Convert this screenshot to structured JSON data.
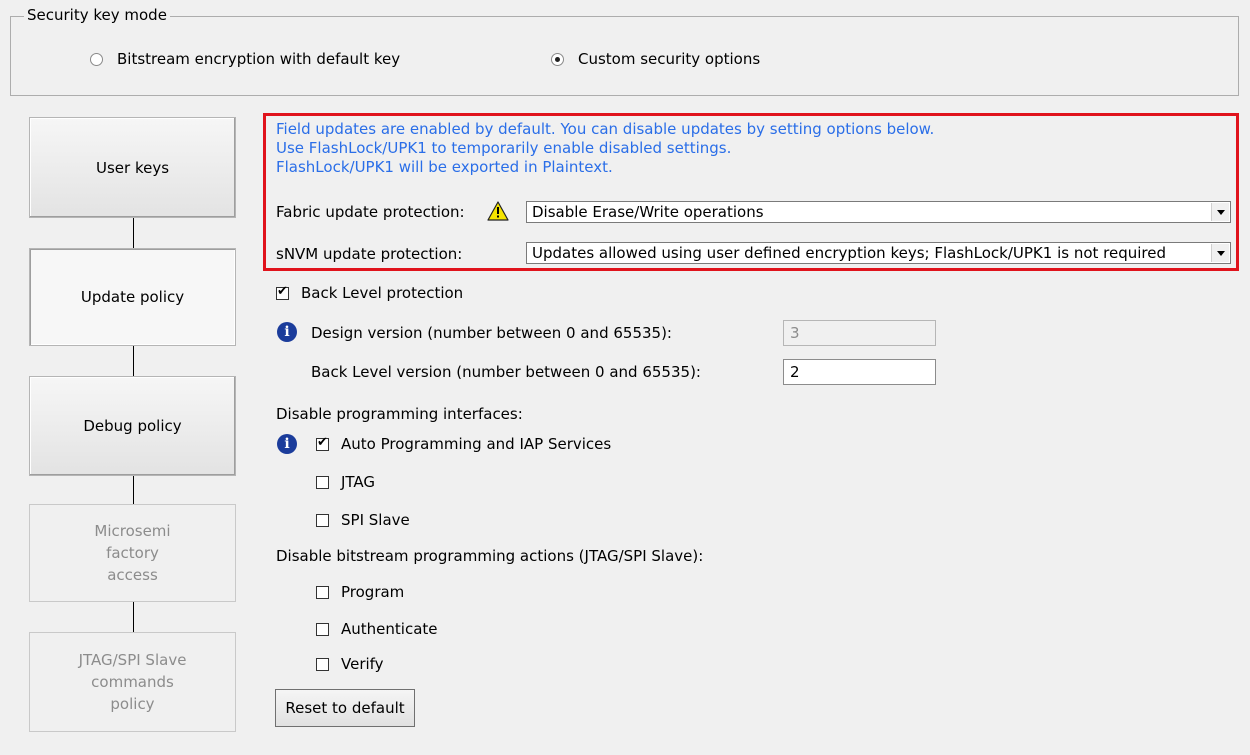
{
  "security_key_mode": {
    "title": "Security key mode",
    "options": [
      {
        "label": "Bitstream encryption with default key",
        "selected": false
      },
      {
        "label": "Custom security options",
        "selected": true
      }
    ]
  },
  "steps": [
    {
      "label": "User keys",
      "state": "normal"
    },
    {
      "label": "Update policy",
      "state": "active"
    },
    {
      "label": "Debug policy",
      "state": "normal"
    },
    {
      "label": "Microsemi factory access",
      "state": "disabled"
    },
    {
      "label": "JTAG/SPI Slave commands policy",
      "state": "disabled"
    }
  ],
  "update_policy": {
    "info_lines": [
      "Field updates are enabled by default. You can disable updates by setting options below.",
      "Use FlashLock/UPK1 to temporarily enable disabled settings.",
      "FlashLock/UPK1 will be exported in Plaintext."
    ],
    "fabric_label": "Fabric update protection:",
    "fabric_value": "Disable Erase/Write operations",
    "snvm_label": "sNVM update protection:",
    "snvm_value": "Updates allowed using user defined encryption keys; FlashLock/UPK1 is not required",
    "back_level_label": "Back Level protection",
    "back_level_checked": true,
    "design_version_label": "Design version (number between 0 and 65535):",
    "design_version_value": "3",
    "back_level_version_label": "Back Level version (number between 0 and 65535):",
    "back_level_version_value": "2",
    "interfaces_heading": "Disable programming interfaces:",
    "interfaces": [
      {
        "label": "Auto Programming and IAP Services",
        "checked": true
      },
      {
        "label": "JTAG",
        "checked": false
      },
      {
        "label": "SPI Slave",
        "checked": false
      }
    ],
    "actions_heading": "Disable bitstream programming actions (JTAG/SPI Slave):",
    "actions": [
      {
        "label": "Program",
        "checked": false
      },
      {
        "label": "Authenticate",
        "checked": false
      },
      {
        "label": "Verify",
        "checked": false
      }
    ],
    "reset_label": "Reset to default"
  },
  "colors": {
    "highlight_border": "#e0131c",
    "info_text": "#2a6ee8",
    "info_icon": "#1b3c9b"
  },
  "icons": [
    "info-icon",
    "warning-icon",
    "dropdown-arrow-icon",
    "checkmark-icon"
  ]
}
